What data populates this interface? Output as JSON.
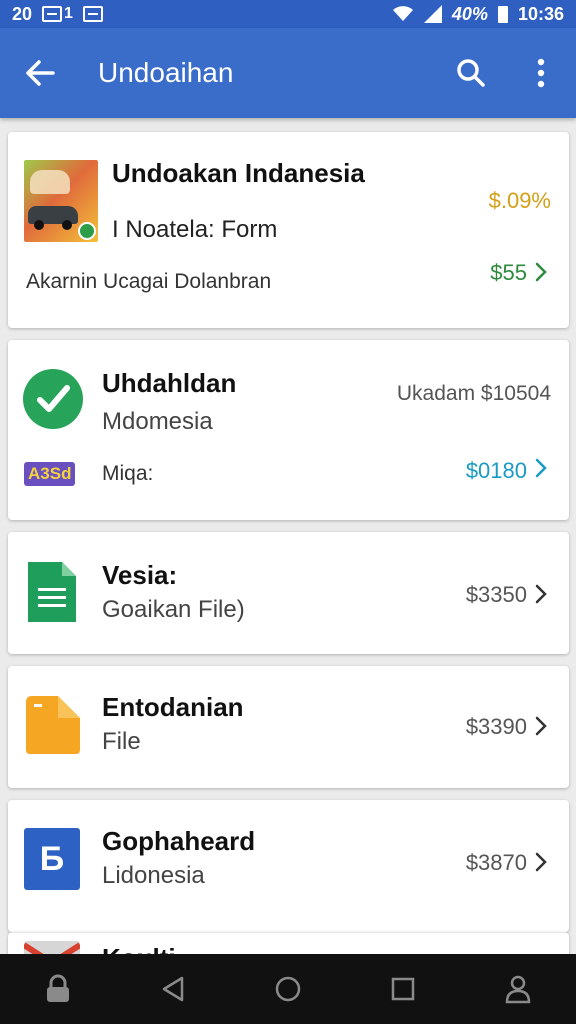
{
  "status_bar": {
    "time_left": "20",
    "carrier": "1",
    "battery_percent": "40%",
    "clock": "10:36"
  },
  "app_bar": {
    "title": "Undoaihan",
    "color": "#3a6cc9"
  },
  "items": [
    {
      "title": "Undoakan Indanesia",
      "subtitle": "I Noatela: Form",
      "detail": "Akarnin Ucagai Dolanbran",
      "percent": "$.09%",
      "price": "$55",
      "percent_color": "#d4a017",
      "price_color": "#2e8b3d",
      "icon": "photo-thumbnail-icon"
    },
    {
      "title": "Uhdahldan",
      "subtitle": "Mdomesia",
      "label_right": "Ukadam $10504",
      "badge": "A3Sd",
      "badge_label": "Miqa:",
      "price": "$0180",
      "price_color": "#1a9bc4",
      "icon": "check-circle-icon"
    },
    {
      "title": "Vesia:",
      "subtitle": "Goaikan File)",
      "price": "$3350",
      "icon": "document-icon"
    },
    {
      "title": "Entodanian",
      "subtitle": "File",
      "price": "$3390",
      "icon": "folder-icon"
    },
    {
      "title": "Gophaheard",
      "subtitle": "Lidonesia",
      "price": "$3870",
      "icon_letter": "Б",
      "icon": "letter-b-icon"
    },
    {
      "title": "Koulti",
      "icon": "gmail-icon"
    }
  ],
  "nav": {
    "items": [
      "lock-icon",
      "back-triangle-icon",
      "home-circle-icon",
      "recents-square-icon",
      "person-icon"
    ]
  }
}
